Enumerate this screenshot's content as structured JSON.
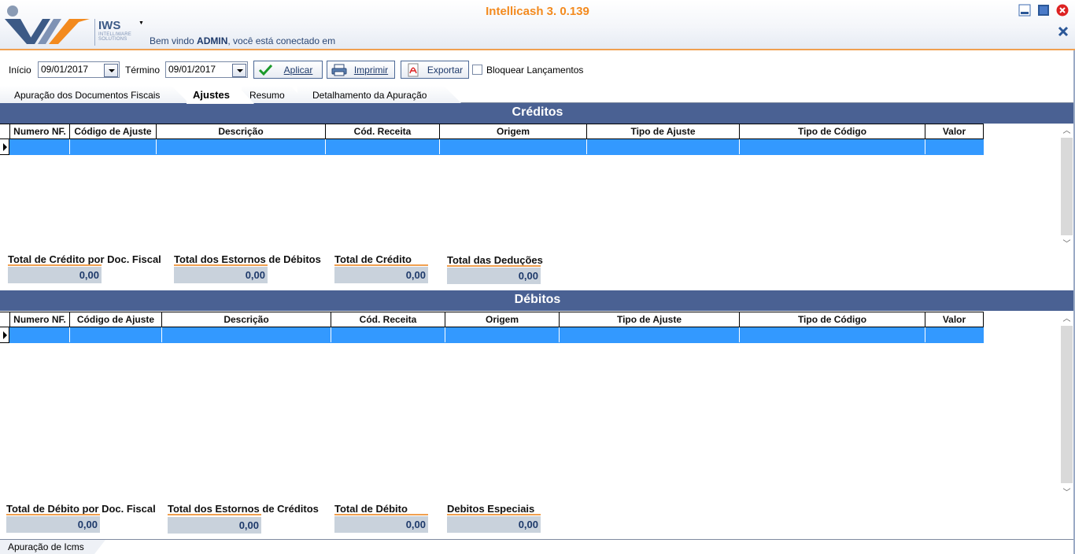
{
  "header": {
    "app_title": "Intellicash 3. 0.139",
    "logo_text": "IWS",
    "logo_sub1": "INTELLIWARE",
    "logo_sub2": "SOLUTIONS",
    "welcome_prefix": "Bem vindo ",
    "welcome_user": "ADMIN",
    "welcome_suffix": ", você está conectado em"
  },
  "toolbar": {
    "inicio_label": "Início",
    "inicio_value": "09/01/2017",
    "termino_label": "Término",
    "termino_value": "09/01/2017",
    "aplicar": "Aplicar",
    "imprimir": "Imprimir",
    "exportar": "Exportar",
    "bloquear": "Bloquear Lançamentos"
  },
  "tabs": [
    {
      "label": "Apuração dos Documentos Fiscais",
      "active": false
    },
    {
      "label": "Ajustes",
      "active": true
    },
    {
      "label": "Resumo",
      "active": false
    },
    {
      "label": "Detalhamento da Apuração",
      "active": false
    }
  ],
  "creditos": {
    "title": "Créditos",
    "columns": [
      "Numero NF.",
      "Código de Ajuste",
      "Descrição",
      "Cód. Receita",
      "Origem",
      "Tipo de Ajuste",
      "Tipo de Código",
      "Valor"
    ],
    "totals": [
      {
        "label": "Total de Crédito por Doc. Fiscal",
        "value": "0,00"
      },
      {
        "label": "Total dos Estornos de Débitos",
        "value": "0,00"
      },
      {
        "label": "Total de Crédito",
        "value": "0,00"
      },
      {
        "label": "Total das Deduções",
        "value": "0,00"
      }
    ]
  },
  "debitos": {
    "title": "Débitos",
    "columns": [
      "Numero NF.",
      "Código de Ajuste",
      "Descrição",
      "Cód. Receita",
      "Origem",
      "Tipo de Ajuste",
      "Tipo de Código",
      "Valor"
    ],
    "totals": [
      {
        "label": "Total de Débito por Doc. Fiscal",
        "value": "0,00"
      },
      {
        "label": "Total dos Estornos de Créditos",
        "value": "0,00"
      },
      {
        "label": "Total de Débito",
        "value": "0,00"
      },
      {
        "label": "Debitos Especiais",
        "value": "0,00"
      }
    ]
  },
  "bottom_tab": "Apuração de Icms",
  "colors": {
    "band": "#4a6193",
    "selected_row": "#3399ff",
    "accent_orange": "#f38a1e",
    "total_box": "#c9d2dc"
  },
  "icons": [
    "logo-icon",
    "dropdown-arrow-icon",
    "minimize-icon",
    "maximize-icon",
    "close-icon",
    "close-x-icon",
    "calendar-dropdown-icon",
    "check-icon",
    "printer-icon",
    "pdf-icon",
    "row-pointer-icon",
    "scroll-up-icon",
    "scroll-down-icon"
  ]
}
